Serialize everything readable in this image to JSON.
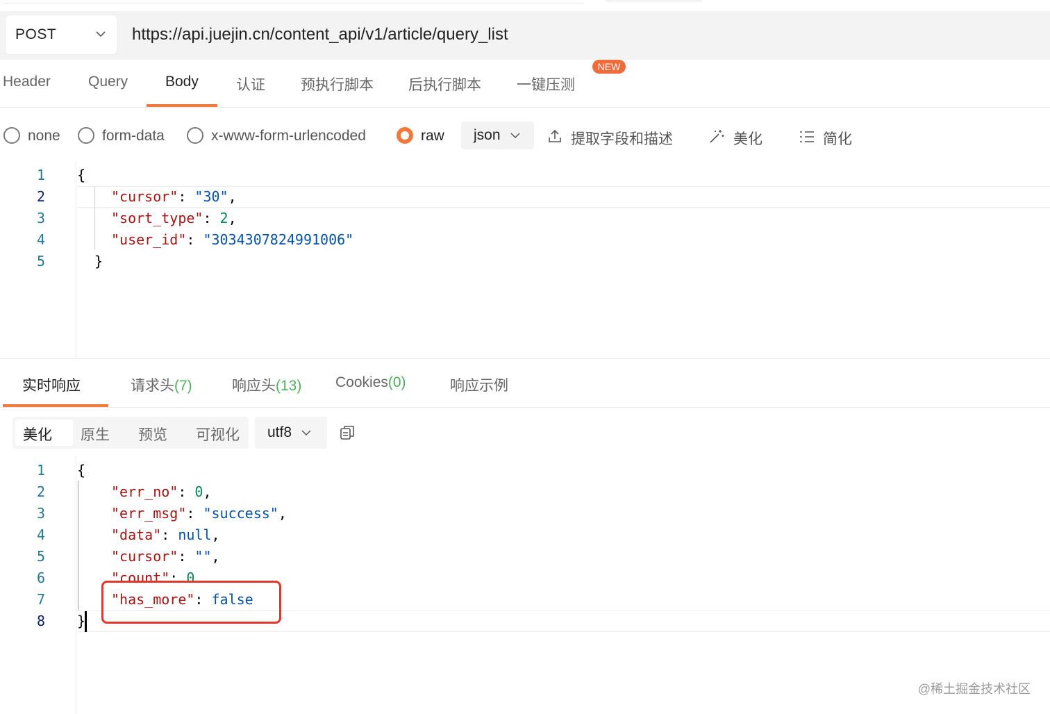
{
  "request": {
    "method": "POST",
    "url": "https://api.juejin.cn/content_api/v1/article/query_list"
  },
  "request_tabs": [
    {
      "label": "Header"
    },
    {
      "label": "Query"
    },
    {
      "label": "Body"
    },
    {
      "label": "认证"
    },
    {
      "label": "预执行脚本"
    },
    {
      "label": "后执行脚本"
    },
    {
      "label": "一键压测"
    }
  ],
  "active_request_tab": "Body",
  "new_badge": "NEW",
  "body_modes": [
    {
      "label": "none",
      "selected": false
    },
    {
      "label": "form-data",
      "selected": false
    },
    {
      "label": "x-www-form-urlencoded",
      "selected": false
    },
    {
      "label": "raw",
      "selected": true
    }
  ],
  "body_format": "json",
  "body_tools": {
    "extract": "提取字段和描述",
    "beautify": "美化",
    "simplify": "简化"
  },
  "request_body_lines": [
    "1",
    "2",
    "3",
    "4",
    "5"
  ],
  "request_body": {
    "open": "{",
    "cursor_key": "\"cursor\"",
    "cursor_val": "\"30\"",
    "sort_type_key": "\"sort_type\"",
    "sort_type_val": "2",
    "user_id_key": "\"user_id\"",
    "user_id_val": "\"3034307824991006\"",
    "close": "}"
  },
  "response_tabs": [
    {
      "label": "实时响应",
      "count": ""
    },
    {
      "label": "请求头",
      "count": "(7)"
    },
    {
      "label": "响应头",
      "count": "(13)"
    },
    {
      "label": "Cookies",
      "count": "(0)"
    },
    {
      "label": "响应示例",
      "count": ""
    }
  ],
  "active_response_tab": "实时响应",
  "response_views": [
    {
      "label": "美化"
    },
    {
      "label": "原生"
    },
    {
      "label": "预览"
    },
    {
      "label": "可视化"
    }
  ],
  "response_encoding": "utf8",
  "response_body_lines": [
    "1",
    "2",
    "3",
    "4",
    "5",
    "6",
    "7",
    "8"
  ],
  "response_body": {
    "open": "{",
    "err_no_key": "\"err_no\"",
    "err_no_val": "0",
    "err_msg_key": "\"err_msg\"",
    "err_msg_val": "\"success\"",
    "data_key": "\"data\"",
    "data_val": "null",
    "cursor_key": "\"cursor\"",
    "cursor_val": "\"\"",
    "count_key": "\"count\"",
    "count_val": "0",
    "has_more_key": "\"has_more\"",
    "has_more_val": "false",
    "close": "}"
  },
  "watermark": "@稀土掘金技术社区",
  "colors": {
    "accent": "#f07a3c",
    "highlight_box": "#e0382a",
    "count_green": "#4bb05a",
    "json_key": "#a31515",
    "json_string": "#0451a5",
    "json_number": "#098658"
  }
}
